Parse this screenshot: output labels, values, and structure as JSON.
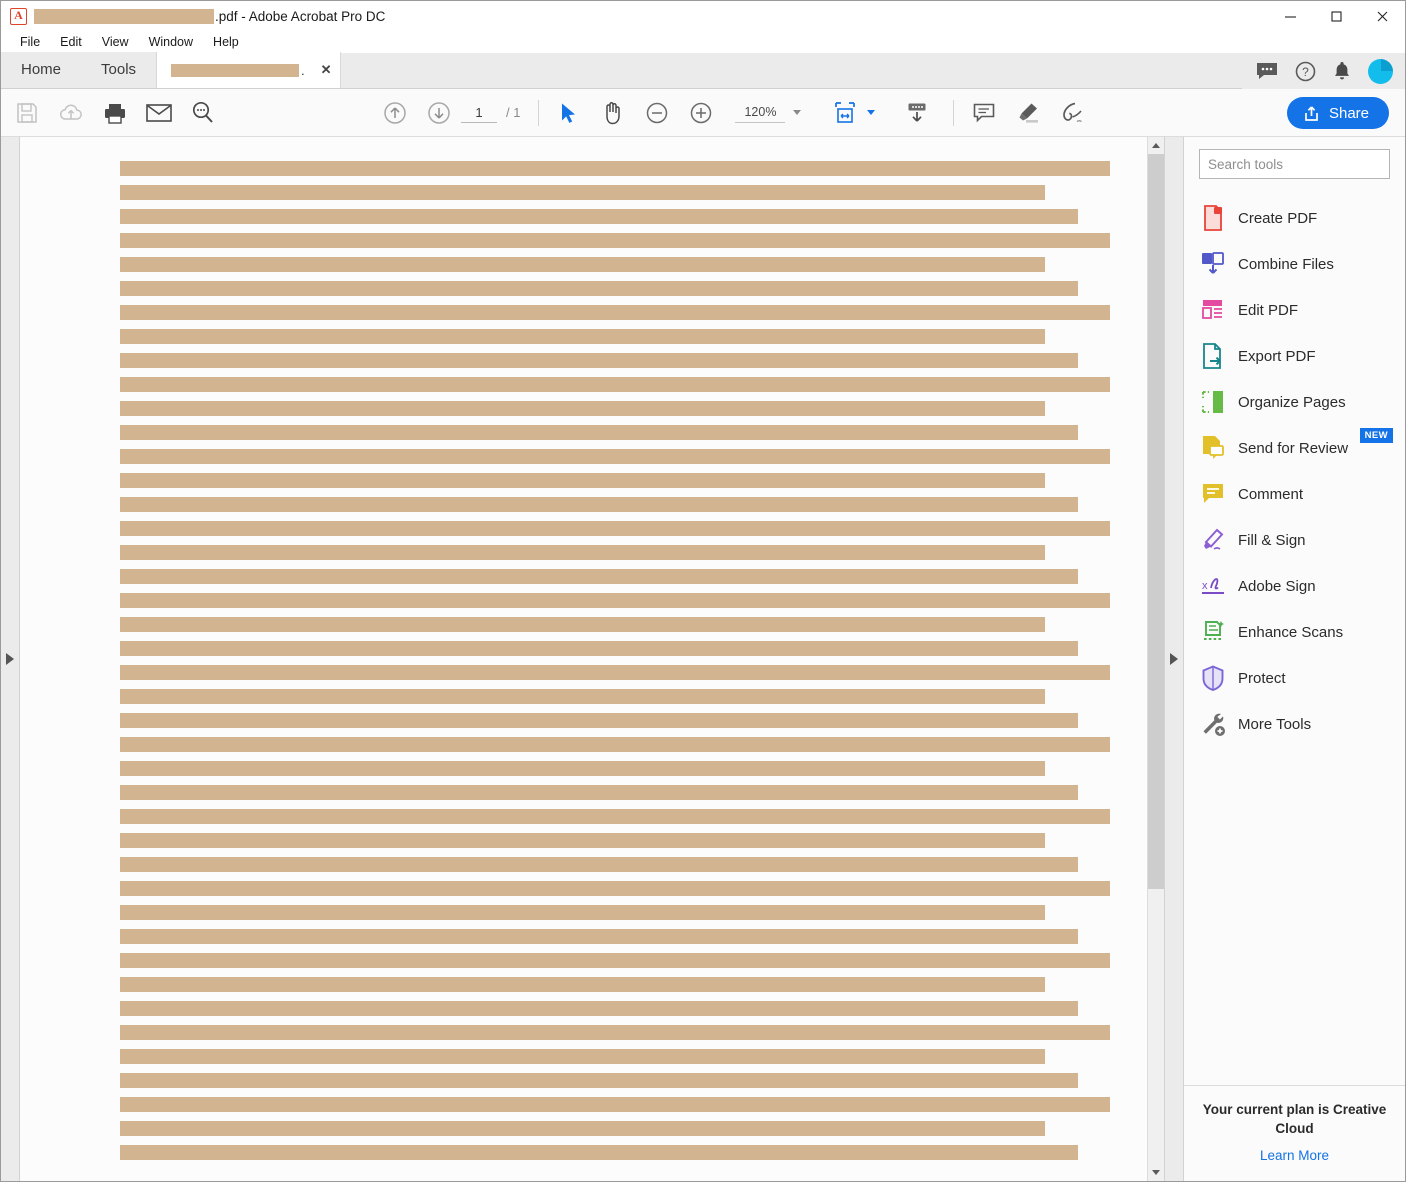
{
  "window": {
    "title_suffix": ".pdf - Adobe Acrobat Pro DC",
    "filename_redacted": true,
    "controls": {
      "minimize": "—",
      "maximize": "□",
      "close": "✕"
    }
  },
  "menubar": {
    "items": [
      "File",
      "Edit",
      "View",
      "Window",
      "Help"
    ]
  },
  "tabs": {
    "home_label": "Home",
    "tools_label": "Tools",
    "document_tab_suffix": ".",
    "close_label": "✕"
  },
  "header_icons": [
    {
      "name": "chat-icon"
    },
    {
      "name": "help-icon"
    },
    {
      "name": "bell-icon"
    },
    {
      "name": "avatar"
    }
  ],
  "toolbar": {
    "save_label": "Save",
    "upload_label": "Save to cloud",
    "print_label": "Print",
    "email_label": "Email",
    "search_label": "Find",
    "prev_page_label": "Previous page",
    "next_page_label": "Next page",
    "page_number": "1",
    "page_total": "/ 1",
    "select_tool_label": "Select",
    "hand_tool_label": "Pan",
    "zoom_out_label": "Zoom out",
    "zoom_in_label": "Zoom in",
    "zoom_level": "120%",
    "fit_page_label": "Fit page",
    "read_mode_label": "Read mode",
    "comment_label": "Add comment",
    "highlight_label": "Highlight",
    "sign_label": "Sign",
    "share_label": "Share",
    "accent_color": "#1473e6"
  },
  "tools_panel": {
    "search_placeholder": "Search tools",
    "search_value": "",
    "items": [
      {
        "label": "Create PDF",
        "icon": "create-pdf-icon",
        "color": "#e8443a",
        "badge": ""
      },
      {
        "label": "Combine Files",
        "icon": "combine-files-icon",
        "color": "#5258c8",
        "badge": ""
      },
      {
        "label": "Edit PDF",
        "icon": "edit-pdf-icon",
        "color": "#e34ba0",
        "badge": ""
      },
      {
        "label": "Export PDF",
        "icon": "export-pdf-icon",
        "color": "#17868c",
        "badge": ""
      },
      {
        "label": "Organize Pages",
        "icon": "organize-pages-icon",
        "color": "#65bb46",
        "badge": ""
      },
      {
        "label": "Send for Review",
        "icon": "send-review-icon",
        "color": "#e2c029",
        "badge": "NEW"
      },
      {
        "label": "Comment",
        "icon": "comment-icon",
        "color": "#e2c029",
        "badge": ""
      },
      {
        "label": "Fill & Sign",
        "icon": "fill-sign-icon",
        "color": "#8d5fd3",
        "badge": ""
      },
      {
        "label": "Adobe Sign",
        "icon": "adobe-sign-icon",
        "color": "#7a4bc4",
        "badge": ""
      },
      {
        "label": "Enhance Scans",
        "icon": "enhance-scans-icon",
        "color": "#4caf50",
        "badge": ""
      },
      {
        "label": "Protect",
        "icon": "protect-icon",
        "color": "#7b66d6",
        "badge": ""
      },
      {
        "label": "More Tools",
        "icon": "more-tools-icon",
        "color": "#6e6e6e",
        "badge": ""
      }
    ],
    "plan_text": "Your current plan is Creative Cloud",
    "plan_link": "Learn More"
  },
  "document": {
    "redaction_color": "#d2b490",
    "page_background": "#fcfcfc",
    "line_left_margin": 100,
    "line_height": 15,
    "line_gap": 9,
    "line_widths": [
      990,
      925,
      958,
      990,
      925,
      958,
      990,
      925,
      958,
      990,
      925,
      958,
      990,
      925,
      958,
      990,
      925,
      958,
      990,
      925,
      958,
      990,
      925,
      958,
      990,
      925,
      958,
      990,
      925,
      958,
      990,
      925,
      958,
      990,
      925,
      958,
      990,
      925,
      958,
      990,
      925,
      958
    ]
  }
}
